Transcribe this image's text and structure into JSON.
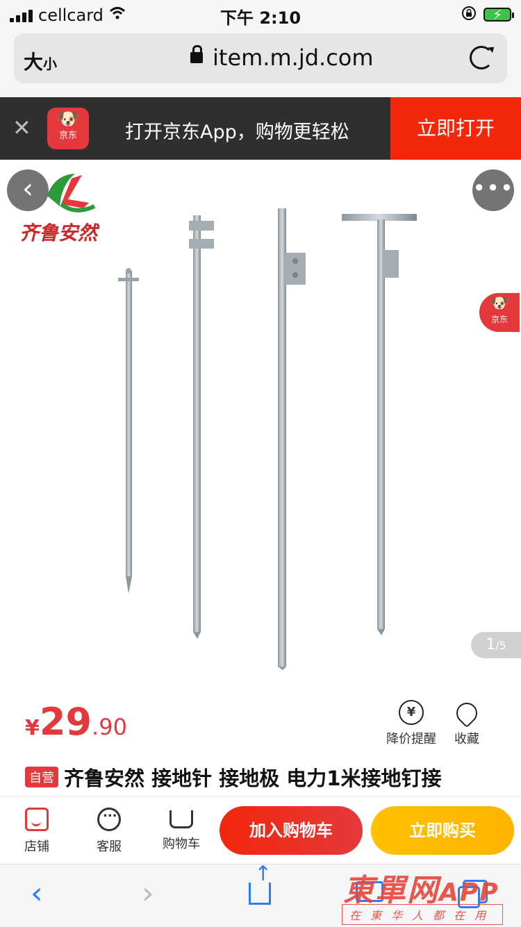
{
  "status_bar": {
    "carrier": "cellcard",
    "time": "下午 2:10"
  },
  "browser": {
    "text_size_label_big": "大",
    "text_size_label_small": "小",
    "url": "item.m.jd.com"
  },
  "app_banner": {
    "logo_text": "京东",
    "message": "打开京东App，购物更轻松",
    "open_button": "立即打开"
  },
  "product_image": {
    "brand_name": "齐鲁安然",
    "float_logo_text": "京东",
    "counter_current": "1",
    "counter_total": "/5",
    "brand_color": "#c8282a"
  },
  "price": {
    "currency": "¥",
    "integer": "29",
    "decimal": ".90",
    "color": "#e4393c"
  },
  "price_actions": {
    "price_alert_label": "降价提醒",
    "price_alert_icon_glyph": "¥",
    "favorite_label": "收藏"
  },
  "product": {
    "badge": "自营",
    "title": "齐鲁安然 接地针 接地极 电力1米接地钉接"
  },
  "action_bar": {
    "shop_label": "店铺",
    "service_label": "客服",
    "cart_label": "购物车",
    "add_to_cart": "加入购物车",
    "buy_now": "立即购买",
    "accent_red": "#f2270c",
    "accent_yellow": "#ffb400"
  },
  "safari_toolbar": {
    "back_glyph": "‹",
    "forward_glyph": "›",
    "tint": "#2f7cf6"
  },
  "watermark": {
    "main": "東單网",
    "app": "APP",
    "sub": "在東华人都在用"
  }
}
